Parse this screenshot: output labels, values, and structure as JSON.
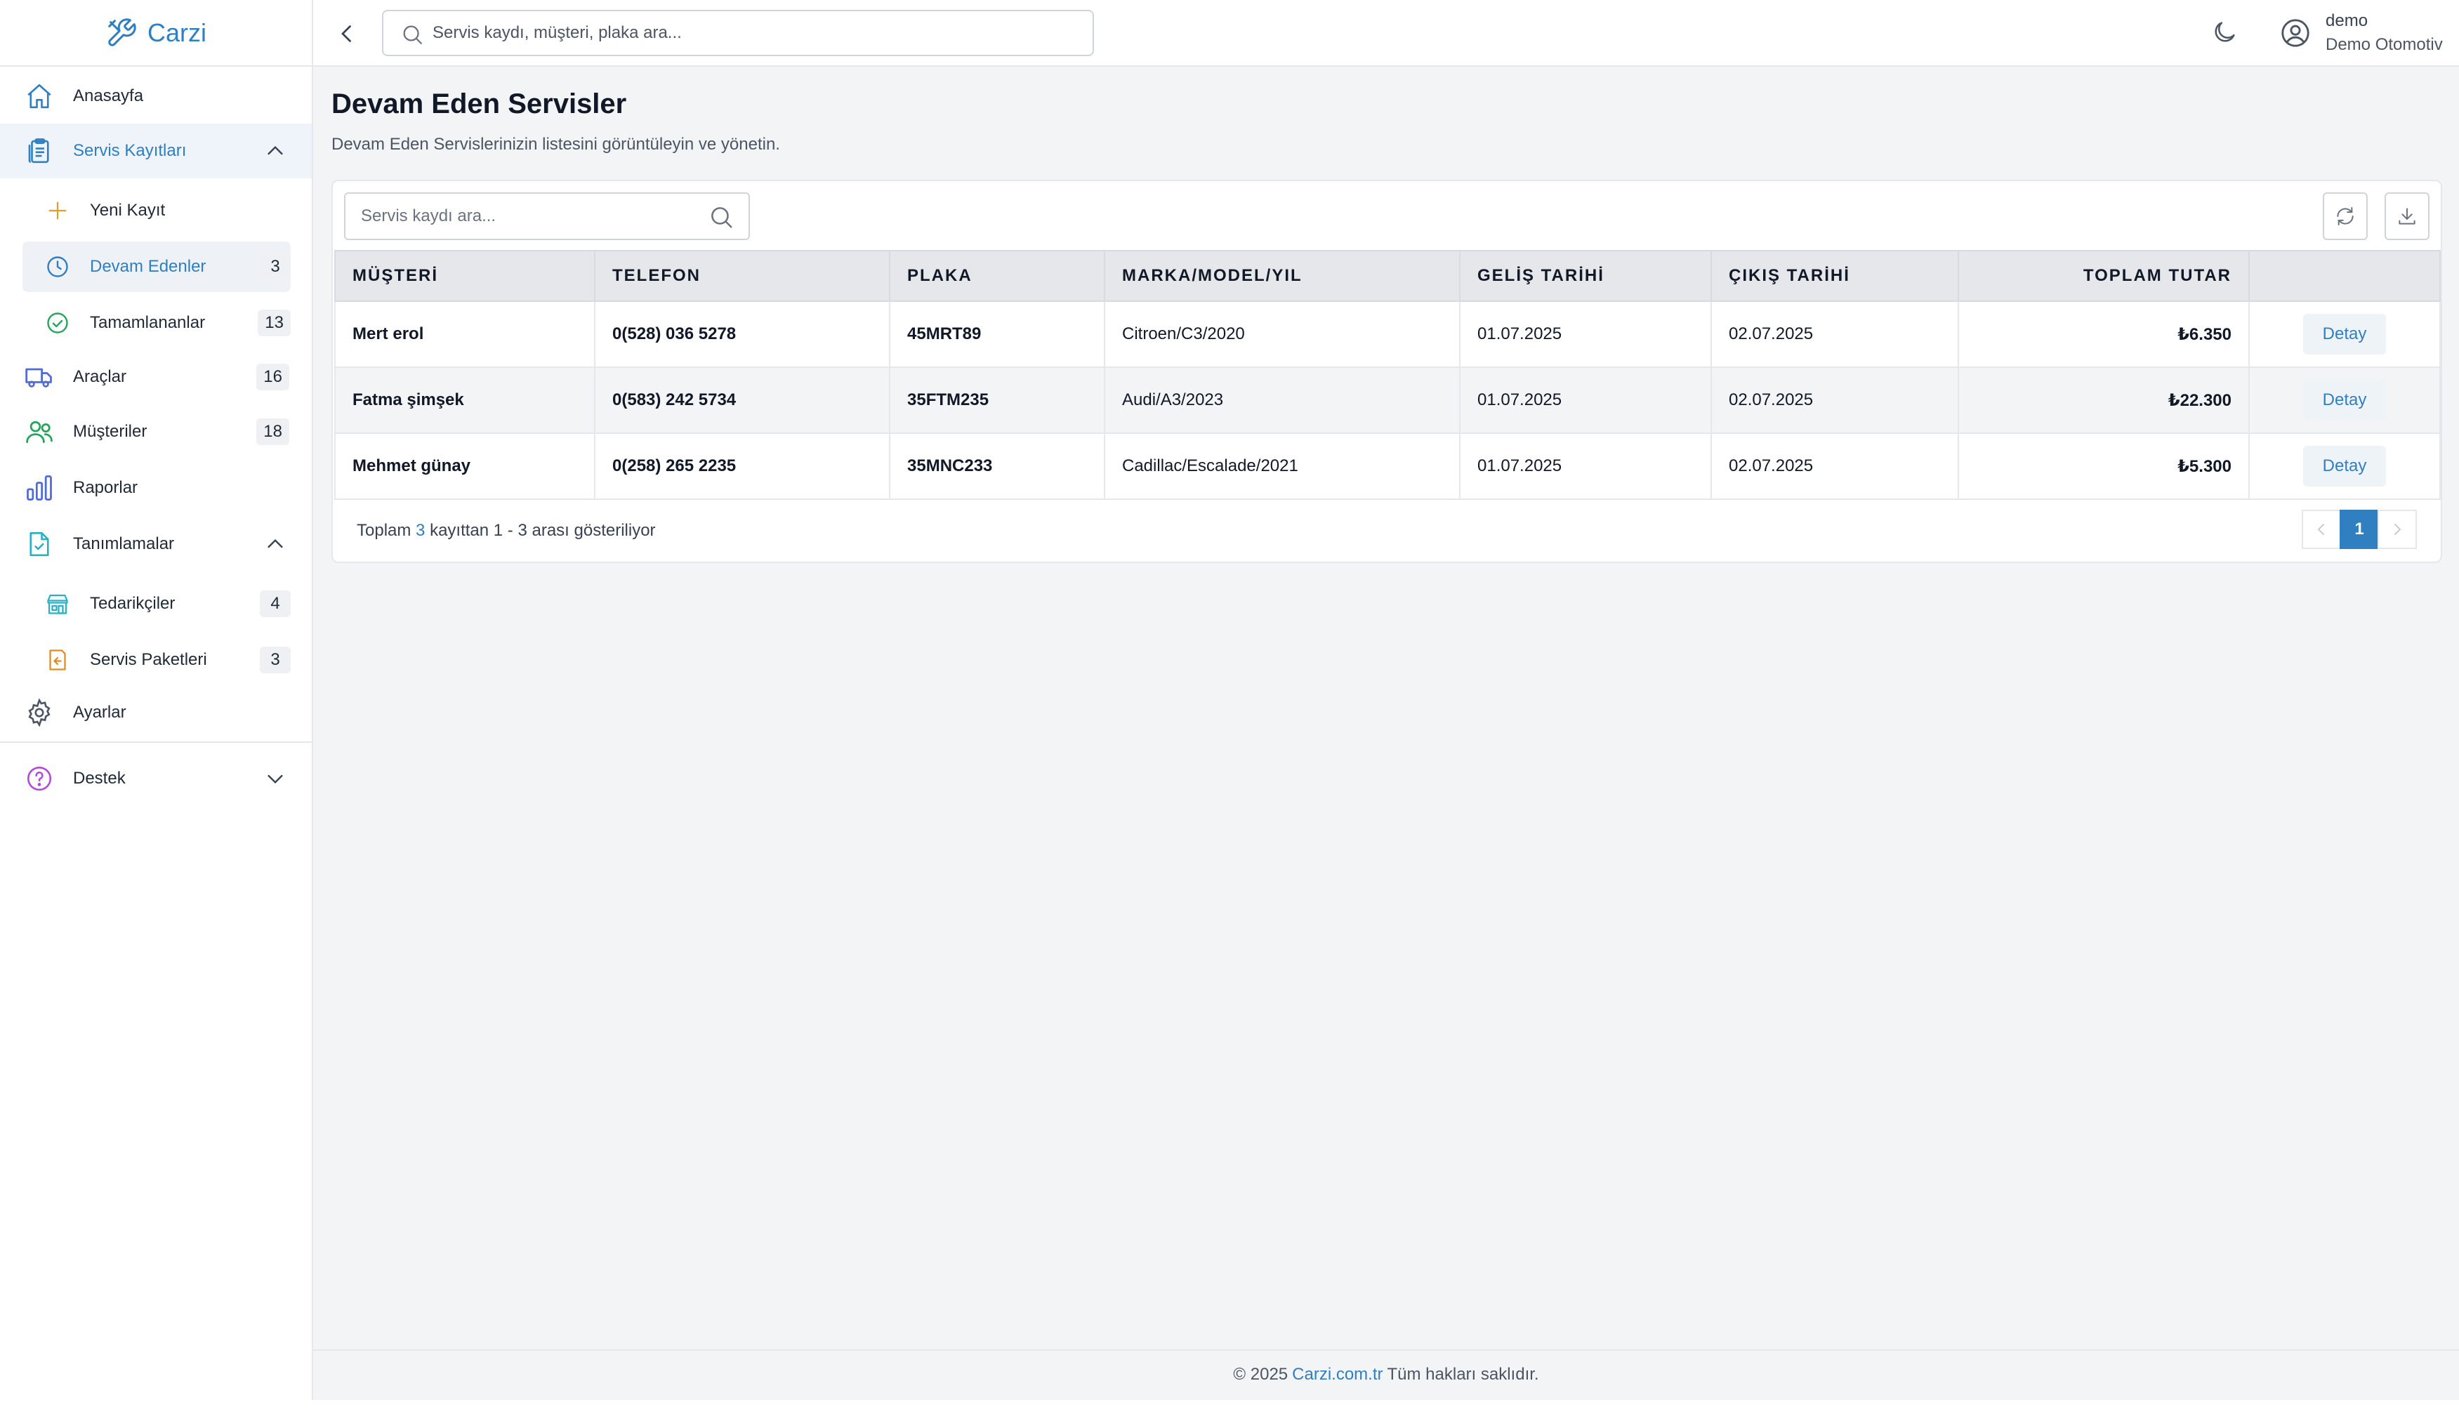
{
  "app": {
    "name": "Carzi"
  },
  "sidebar": {
    "items": [
      {
        "label": "Anasayfa",
        "icon": "home-icon"
      },
      {
        "label": "Servis Kayıtları",
        "icon": "clipboard-icon"
      },
      {
        "label": "Yeni Kayıt",
        "icon": "plus-icon"
      },
      {
        "label": "Devam Edenler",
        "icon": "clock-icon",
        "count": "3"
      },
      {
        "label": "Tamamlananlar",
        "icon": "check-circle-icon",
        "count": "13"
      },
      {
        "label": "Araçlar",
        "icon": "truck-icon",
        "count": "16"
      },
      {
        "label": "Müşteriler",
        "icon": "users-icon",
        "count": "18"
      },
      {
        "label": "Raporlar",
        "icon": "bar-chart-icon"
      },
      {
        "label": "Tanımlamalar",
        "icon": "document-check-icon"
      },
      {
        "label": "Tedarikçiler",
        "icon": "store-icon",
        "count": "4"
      },
      {
        "label": "Servis Paketleri",
        "icon": "receipt-icon",
        "count": "3"
      },
      {
        "label": "Ayarlar",
        "icon": "gear-icon"
      },
      {
        "label": "Destek",
        "icon": "question-circle-icon"
      }
    ]
  },
  "topbar": {
    "search_placeholder": "Servis kaydı, müşteri, plaka ara...",
    "user_name": "demo",
    "user_company": "Demo Otomotiv"
  },
  "main": {
    "title": "Devam Eden Servisler",
    "subtitle": "Devam Eden Servislerinizin listesini görüntüleyin ve yönetin.",
    "table_search_placeholder": "Servis kaydı ara...",
    "columns": [
      "MÜŞTERİ",
      "TELEFON",
      "PLAKA",
      "MARKA/MODEL/YIL",
      "GELİŞ TARİHİ",
      "ÇIKIŞ TARİHİ",
      "TOPLAM TUTAR"
    ],
    "rows": [
      {
        "customer": "Mert erol",
        "phone": "0(528) 036 5278",
        "plate": "45MRT89",
        "vehicle": "Citroen/C3/2020",
        "in_date": "01.07.2025",
        "out_date": "02.07.2025",
        "total": "₺6.350",
        "action": "Detay"
      },
      {
        "customer": "Fatma şimşek",
        "phone": "0(583) 242 5734",
        "plate": "35FTM235",
        "vehicle": "Audi/A3/2023",
        "in_date": "01.07.2025",
        "out_date": "02.07.2025",
        "total": "₺22.300",
        "action": "Detay"
      },
      {
        "customer": "Mehmet günay",
        "phone": "0(258) 265 2235",
        "plate": "35MNC233",
        "vehicle": "Cadillac/Escalade/2021",
        "in_date": "01.07.2025",
        "out_date": "02.07.2025",
        "total": "₺5.300",
        "action": "Detay"
      }
    ],
    "pager": {
      "prefix": "Toplam",
      "count": "3",
      "suffix": "kayıttan 1 - 3 arası gösteriliyor",
      "current_page": "1"
    }
  },
  "footer": {
    "prefix": "© 2025",
    "link": "Carzi.com.tr",
    "suffix": "Tüm hakları saklıdır."
  },
  "colors": {
    "accent": "#2f7fc1",
    "background": "#f3f4f6",
    "border": "#e5e7eb"
  }
}
